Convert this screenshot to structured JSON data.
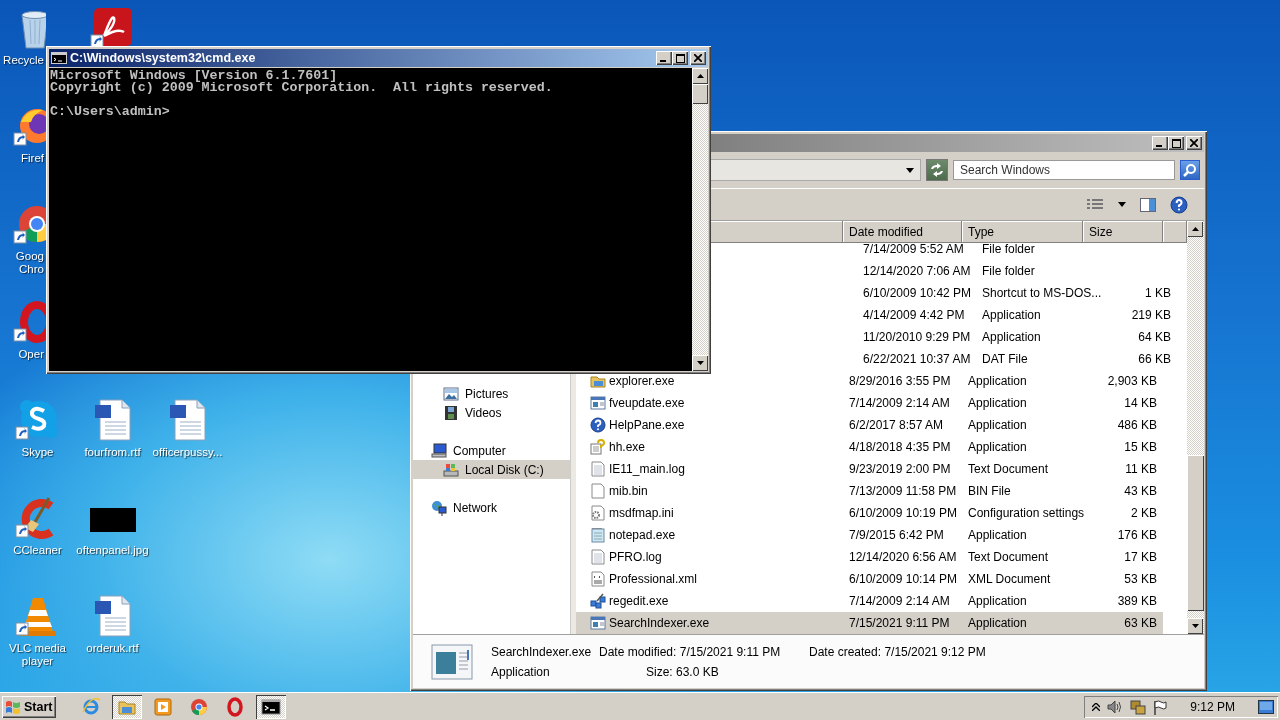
{
  "desktop": {
    "icons": [
      {
        "kind": "recycle-bin",
        "lines": [
          "Recycle"
        ],
        "shortcut": false
      },
      {
        "kind": "pdf",
        "shortcut": true
      },
      {
        "kind": "firefox",
        "lines": [
          "Firef"
        ],
        "shortcut": true
      },
      {
        "kind": "chrome",
        "lines": [
          "Goog",
          "Chro"
        ],
        "shortcut": true
      },
      {
        "kind": "opera",
        "lines": [
          "Oper"
        ],
        "shortcut": true
      },
      {
        "kind": "skype",
        "lines": [
          "Skype"
        ],
        "shortcut": true
      },
      {
        "kind": "document",
        "lines": [
          "fourfrom.rtf"
        ],
        "shortcut": false
      },
      {
        "kind": "document",
        "lines": [
          "officerpussy..."
        ],
        "shortcut": false
      },
      {
        "kind": "ccleaner",
        "lines": [
          "CCleaner"
        ],
        "shortcut": true
      },
      {
        "kind": "image",
        "lines": [
          "oftenpanel.jpg"
        ],
        "shortcut": false
      },
      {
        "kind": "vlc",
        "lines": [
          "VLC media player"
        ],
        "shortcut": true
      },
      {
        "kind": "document",
        "lines": [
          "orderuk.rtf"
        ],
        "shortcut": false
      }
    ]
  },
  "explorer_window": {
    "active": false,
    "search": {
      "placeholder": "Search Windows"
    },
    "nav": [
      {
        "children": [
          {
            "label": "Pictures",
            "kind": "pictures",
            "selected": false
          },
          {
            "label": "Videos",
            "kind": "videos",
            "selected": false
          }
        ]
      },
      {
        "label": "Computer",
        "kind": "computer",
        "selected": false,
        "children": [
          {
            "label": "Local Disk (C:)",
            "kind": "drive",
            "selected": true
          }
        ]
      },
      {
        "label": "Network",
        "kind": "network",
        "selected": false
      }
    ],
    "columns": [
      "Date modified",
      "Type",
      "Size"
    ],
    "rows": [
      {
        "date": "7/14/2009 5:52 AM",
        "type": "File folder",
        "selected": false
      },
      {
        "date": "12/14/2020 7:06 AM",
        "type": "File folder",
        "selected": false
      },
      {
        "date": "6/10/2009 10:42 PM",
        "type": "Shortcut to MS-DOS...",
        "size": "1 KB",
        "selected": false
      },
      {
        "date": "4/14/2009 4:42 PM",
        "type": "Application",
        "size": "219 KB",
        "selected": false
      },
      {
        "date": "11/20/2010 9:29 PM",
        "type": "Application",
        "size": "64 KB",
        "selected": false
      },
      {
        "date": "6/22/2021 10:37 AM",
        "type": "DAT File",
        "size": "66 KB",
        "selected": false
      },
      {
        "name": "explorer.exe",
        "kind": "explorer",
        "date": "8/29/2016 3:55 PM",
        "type": "Application",
        "size": "2,903 KB",
        "selected": false
      },
      {
        "name": "fveupdate.exe",
        "kind": "window",
        "date": "7/14/2009 2:14 AM",
        "type": "Application",
        "size": "14 KB",
        "selected": false
      },
      {
        "name": "HelpPane.exe",
        "kind": "help",
        "date": "6/2/2017 8:57 AM",
        "type": "Application",
        "size": "486 KB",
        "selected": false
      },
      {
        "name": "hh.exe",
        "kind": "hh",
        "date": "4/18/2018 4:35 PM",
        "type": "Application",
        "size": "15 KB",
        "selected": false
      },
      {
        "name": "IE11_main.log",
        "kind": "text",
        "date": "9/23/2019 2:00 PM",
        "type": "Text Document",
        "size": "11 KB",
        "selected": false
      },
      {
        "name": "mib.bin",
        "kind": "blank",
        "date": "7/13/2009 11:58 PM",
        "type": "BIN File",
        "size": "43 KB",
        "selected": false
      },
      {
        "name": "msdfmap.ini",
        "kind": "settings",
        "date": "6/10/2009 10:19 PM",
        "type": "Configuration settings",
        "size": "2 KB",
        "selected": false
      },
      {
        "name": "notepad.exe",
        "kind": "notepad",
        "date": "7/9/2015 6:42 PM",
        "type": "Application",
        "size": "176 KB",
        "selected": false
      },
      {
        "name": "PFRO.log",
        "kind": "text",
        "date": "12/14/2020 6:56 AM",
        "type": "Text Document",
        "size": "17 KB",
        "selected": false
      },
      {
        "name": "Professional.xml",
        "kind": "xml",
        "date": "6/10/2009 10:14 PM",
        "type": "XML Document",
        "size": "53 KB",
        "selected": false
      },
      {
        "name": "regedit.exe",
        "kind": "regedit",
        "date": "7/14/2009 2:14 AM",
        "type": "Application",
        "size": "389 KB",
        "selected": false
      },
      {
        "name": "SearchIndexer.exe",
        "kind": "window",
        "date": "7/15/2021 9:11 PM",
        "type": "Application",
        "size": "63 KB",
        "selected": true
      }
    ],
    "details": {
      "name": "SearchIndexer.exe",
      "type": "Application",
      "modified": "Date modified: 7/15/2021 9:11 PM",
      "size": "Size: 63.0 KB",
      "created": "Date created: 7/15/2021 9:12 PM"
    }
  },
  "cmd_window": {
    "title": "C:\\Windows\\system32\\cmd.exe",
    "active": true,
    "output": [
      "Microsoft Windows [Version 6.1.7601]",
      "Copyright (c) 2009 Microsoft Corporation.  All rights reserved."
    ],
    "prompt": "C:\\Users\\admin>"
  },
  "taskbar": {
    "start": "Start",
    "buttons": [
      {
        "kind": "ie",
        "pressed": false
      },
      {
        "kind": "explorer",
        "pressed": true
      },
      {
        "kind": "media",
        "pressed": false
      },
      {
        "kind": "chrome",
        "pressed": false
      },
      {
        "kind": "opera",
        "pressed": false
      },
      {
        "kind": "cmd",
        "pressed": true
      }
    ],
    "time": "9:12 PM"
  }
}
